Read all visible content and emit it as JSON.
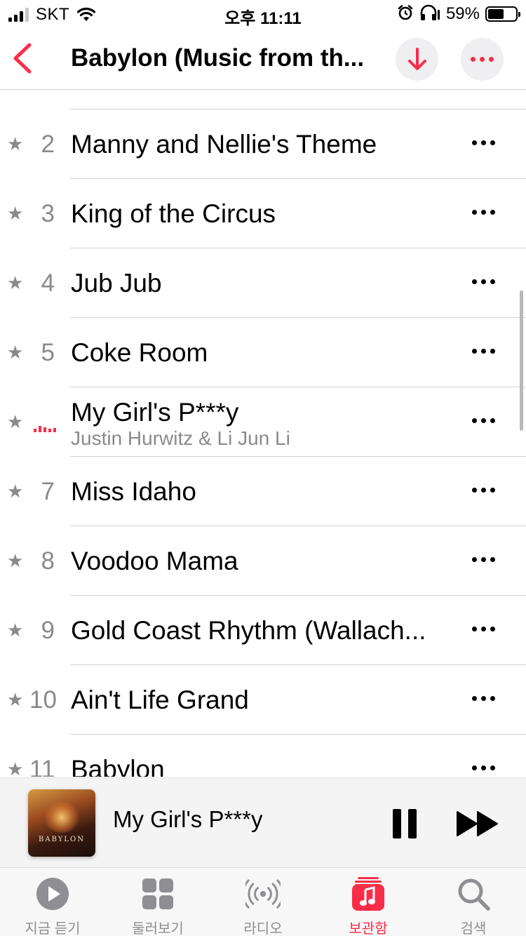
{
  "status_bar": {
    "carrier": "SKT",
    "time": "오후 11:11",
    "battery_percent": "59%",
    "battery_level": 0.59
  },
  "header": {
    "title": "Babylon (Music from th...",
    "back_icon": "chevron-left-icon",
    "download_icon": "arrow-down-icon",
    "more_icon": "ellipsis-icon"
  },
  "tracks": [
    {
      "number": "2",
      "title": "Manny and Nellie's Theme"
    },
    {
      "number": "3",
      "title": "King of the Circus"
    },
    {
      "number": "4",
      "title": "Jub Jub"
    },
    {
      "number": "5",
      "title": "Coke Room"
    },
    {
      "number": "",
      "title": "My Girl's P***y",
      "artist": "Justin Hurwitz & Li Jun Li",
      "playing": true
    },
    {
      "number": "7",
      "title": "Miss Idaho"
    },
    {
      "number": "8",
      "title": "Voodoo Mama"
    },
    {
      "number": "9",
      "title": "Gold Coast Rhythm (Wallach..."
    },
    {
      "number": "10",
      "title": "Ain't Life Grand"
    },
    {
      "number": "11",
      "title": "Babylon"
    }
  ],
  "star_glyph": "★",
  "mini_player": {
    "title": "My Girl's P***y",
    "album_art_text": "BABYLON"
  },
  "tab_bar": {
    "tabs": [
      {
        "label": "지금 듣기",
        "icon": "play-circle-icon"
      },
      {
        "label": "둘러보기",
        "icon": "grid-icon"
      },
      {
        "label": "라디오",
        "icon": "radio-waves-icon"
      },
      {
        "label": "보관함",
        "icon": "library-music-icon",
        "active": true
      },
      {
        "label": "검색",
        "icon": "search-icon"
      }
    ]
  },
  "colors": {
    "accent": "#fa2d48",
    "secondary_text": "#8a8a8e"
  }
}
